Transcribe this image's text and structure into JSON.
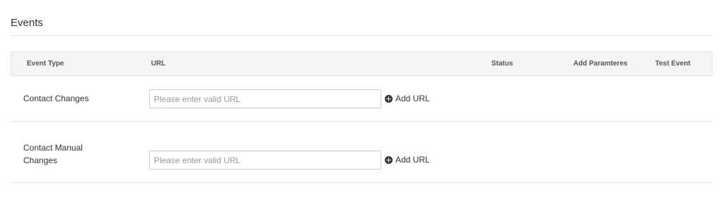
{
  "section": {
    "title": "Events"
  },
  "table": {
    "headers": {
      "event_type": "Event Type",
      "url": "URL",
      "status": "Status",
      "add_parameters": "Add Paramteres",
      "test_event": "Test Event"
    },
    "rows": [
      {
        "event_type": "Contact Changes",
        "url_value": "",
        "url_placeholder": "Please enter valid URL",
        "add_url_label": "Add URL"
      },
      {
        "event_type_line1": "Contact Manual",
        "event_type_line2": "Changes",
        "url_value": "",
        "url_placeholder": "Please enter valid URL",
        "add_url_label": "Add URL"
      }
    ]
  },
  "icons": {
    "add_url": "plus-circle-icon"
  },
  "colors": {
    "header_bg": "#f5f5f5",
    "text": "#333333",
    "placeholder": "#999999"
  }
}
